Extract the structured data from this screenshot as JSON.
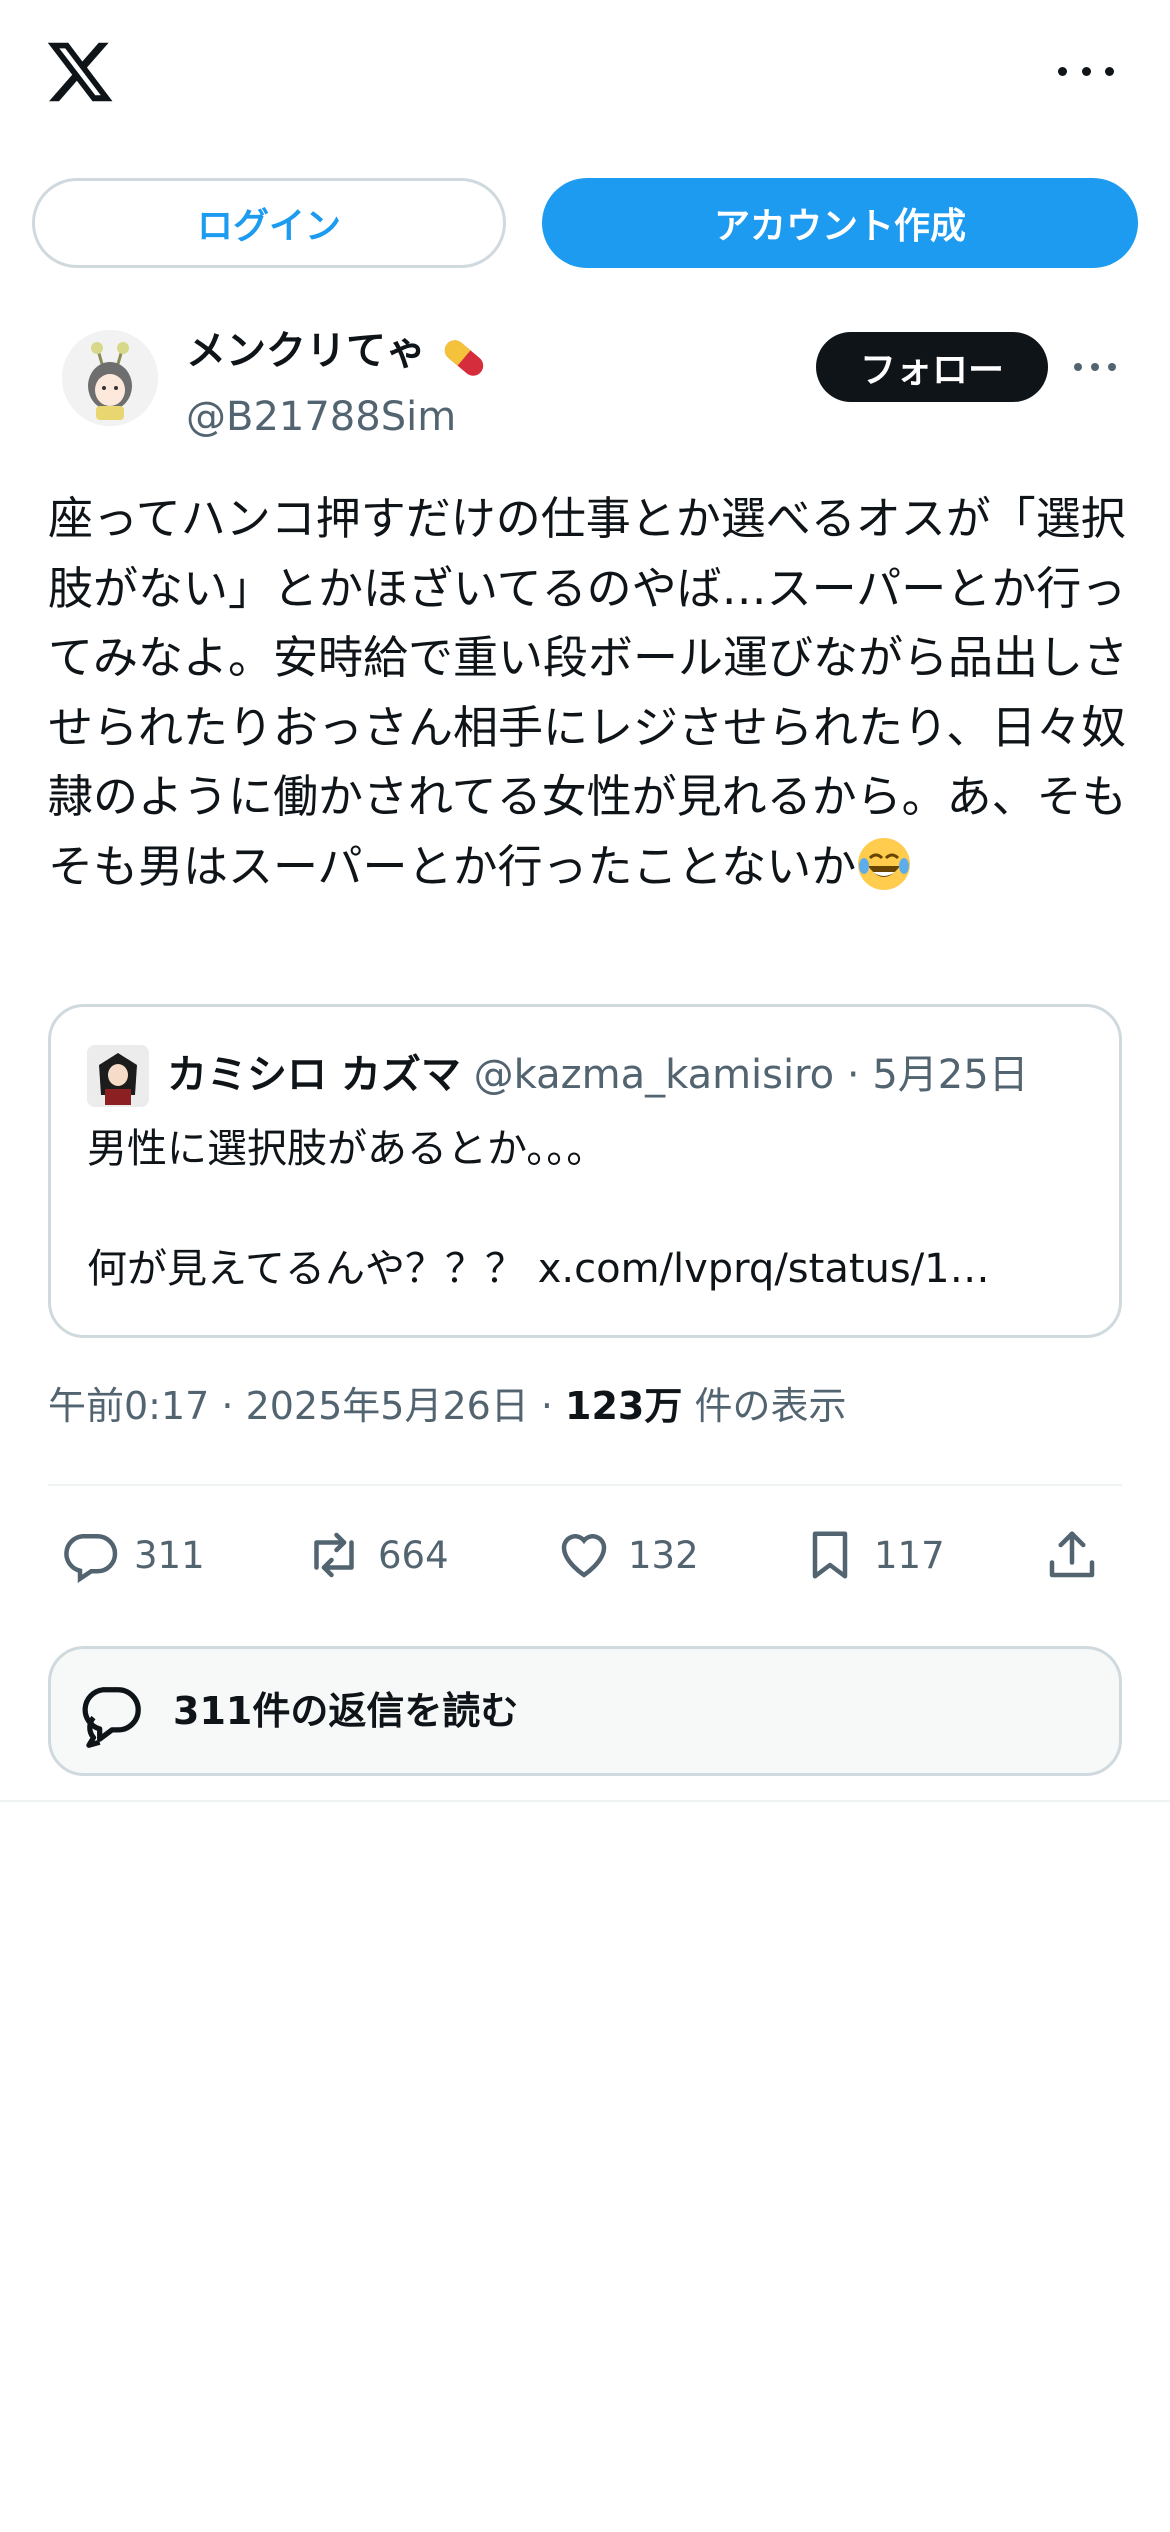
{
  "header": {
    "login_label": "ログイン",
    "signup_label": "アカウント作成"
  },
  "tweet": {
    "author_name": "メンクリてゃ",
    "author_handle": "@B21788Sim",
    "follow_label": "フォロー",
    "text": "座ってハンコ押すだけの仕事とか選べるオスが「選択肢がない」とかほざいてるのやば…スーパーとか行ってみなよ。安時給で重い段ボール運びながら品出しさせられたりおっさん相手にレジさせられたり、日々奴隷のように働かされてる女性が見れるから。あ、そもそも男はスーパーとか行ったことないか",
    "timestamp": "午前0:17 · 2025年5月26日 · ",
    "views": "123万",
    "views_suffix": "件の表示"
  },
  "quote": {
    "name": "カミシロ カズマ",
    "handle": "@kazma_kamisiro",
    "separator": " · ",
    "date": "5月25日",
    "line1": "男性に選択肢があるとか。。。",
    "line2": "何が見えてるんや？？？ x.com/lvprq/status/1…"
  },
  "actions": {
    "replies": "311",
    "reposts": "664",
    "likes": "132",
    "bookmarks": "117"
  },
  "read_replies_label": "311件の返信を読む",
  "colors": {
    "accent": "#1d9bf0",
    "text_primary": "#0f1419",
    "text_secondary": "#536471",
    "border": "#cfd9de"
  },
  "icons": {
    "logo": "x-logo-icon",
    "more": "more-horizontal-icon",
    "reply": "reply-bubble-icon",
    "repost": "repost-icon",
    "like": "heart-icon",
    "bookmark": "bookmark-icon",
    "share": "share-upload-icon",
    "read_replies": "replies-bubbles-icon"
  }
}
